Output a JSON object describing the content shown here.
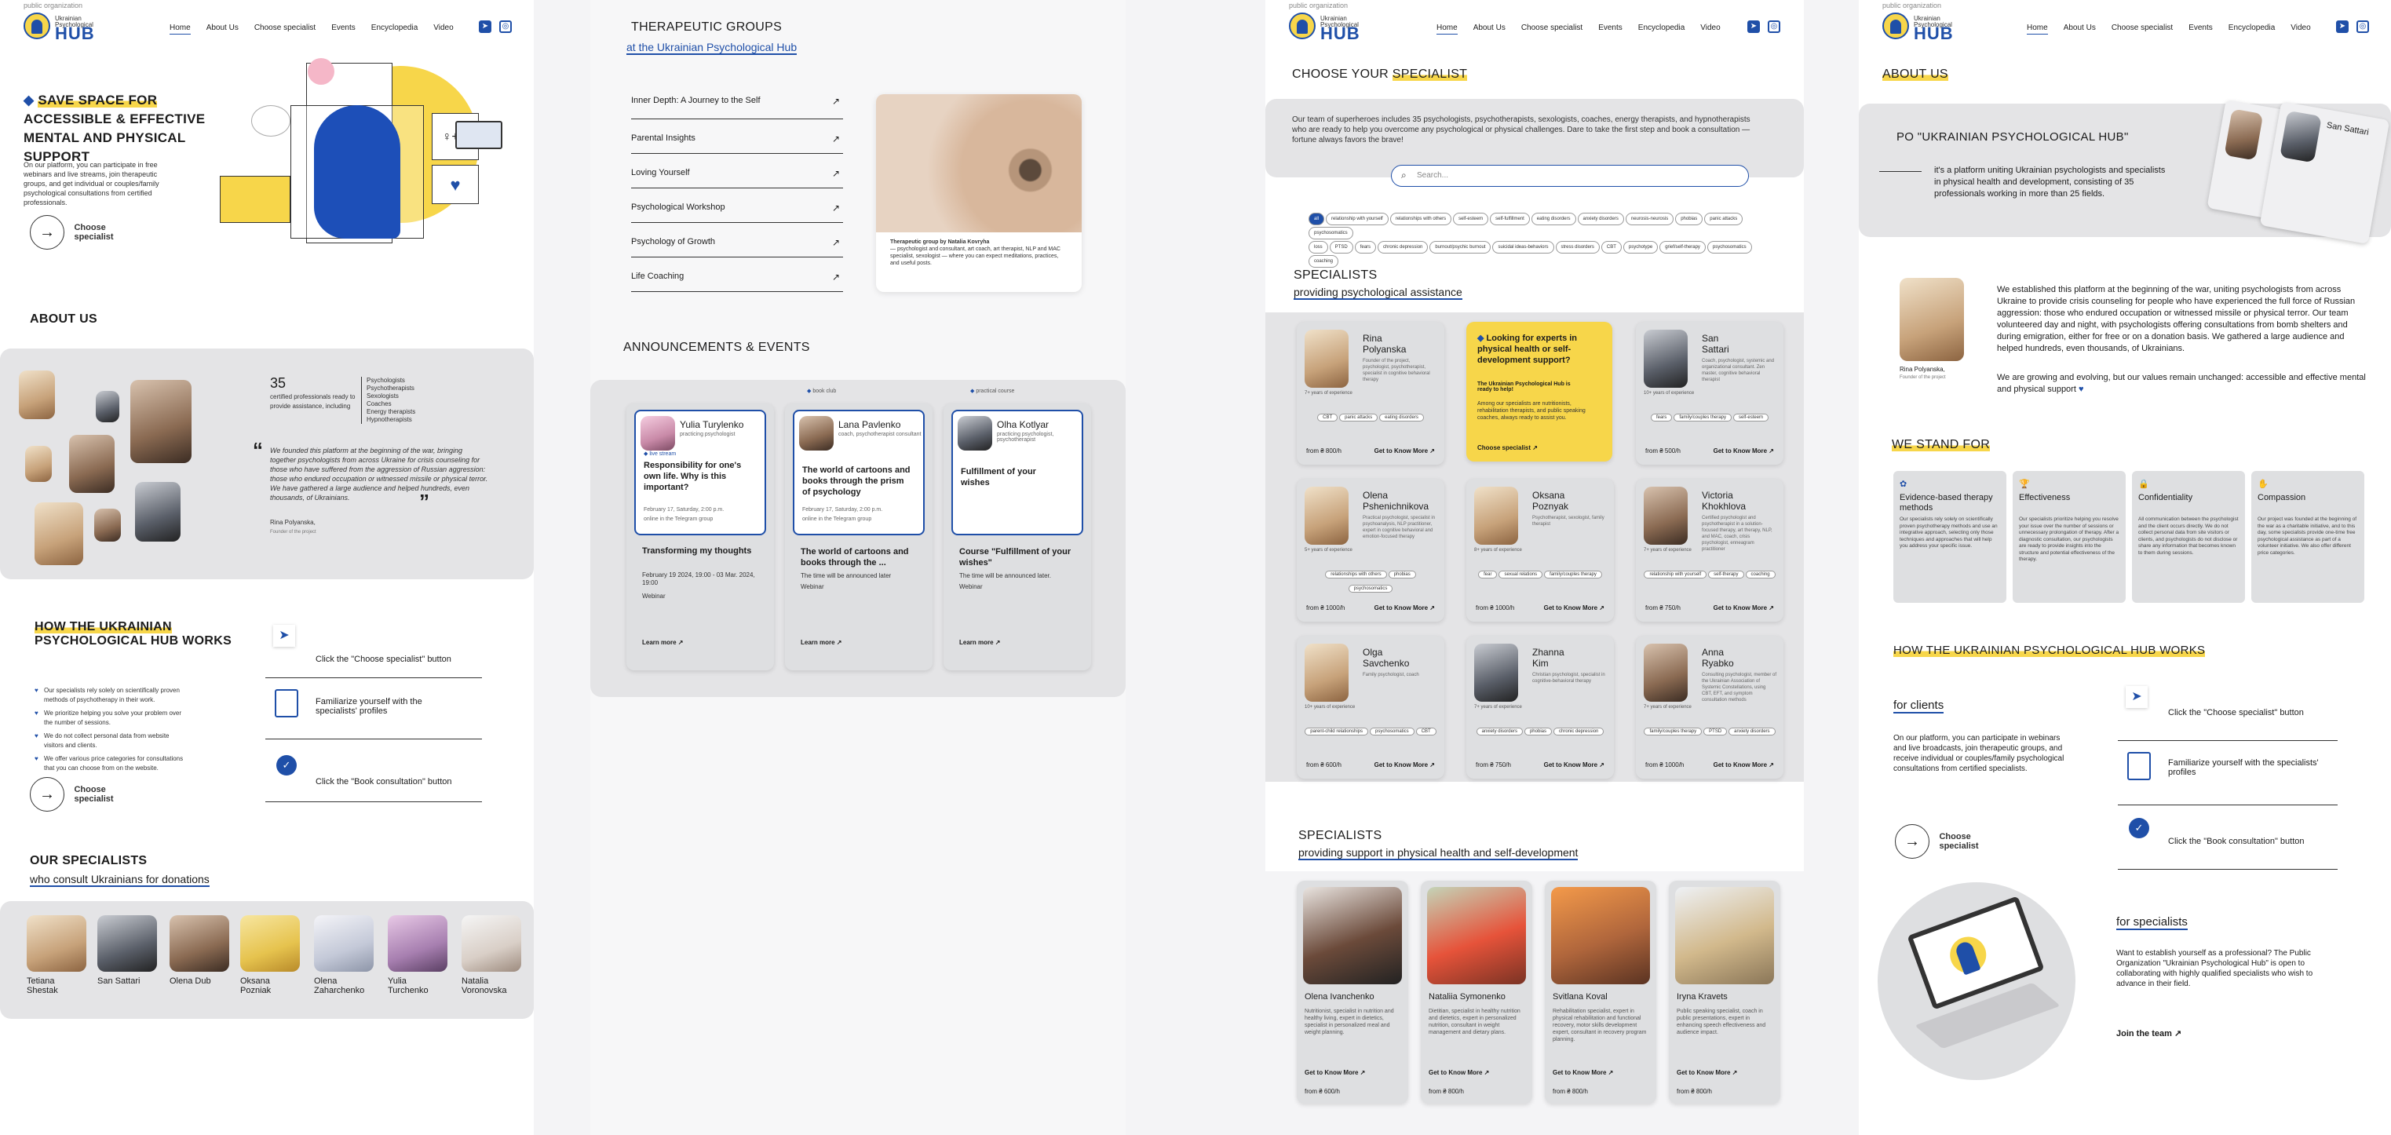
{
  "header": {
    "org": "public organization",
    "logo_line": "Ukrainian Psychological",
    "logo_hub": "HUB",
    "nav": [
      "Home",
      "About Us",
      "Choose specialist",
      "Events",
      "Encyclopedia",
      "Video"
    ],
    "social": [
      "telegram-icon",
      "instagram-icon"
    ]
  },
  "p1": {
    "hero_title_1": "SAVE SPACE FOR",
    "hero_title_2": "ACCESSIBLE & EFFECTIVE",
    "hero_title_3": "MENTAL AND PHYSICAL SUPPORT",
    "hero_text": "On our platform, you can participate in free webinars and live streams, join therapeutic groups, and get individual or couples/family psychological consultations from certified professionals.",
    "choose_label": "Choose specialist",
    "about_title": "ABOUT US",
    "stat_number": "35",
    "stat_text": "certified professionals ready to provide assistance, including",
    "stat_roles": [
      "Psychologists",
      "Psychotherapists",
      "Sexologists",
      "Coaches",
      "Energy therapists",
      "Hypnotherapists"
    ],
    "quote": "We founded this platform at the beginning of the war, bringing together psychologists from across Ukraine for crisis counseling for those who have suffered from the aggression of Russian aggression: those who endured occupation or witnessed missile or physical terror. We have gathered a large audience and helped hundreds, even thousands, of Ukrainians.",
    "quote_author": "Rina Polyanska,",
    "quote_role": "Founder of the project",
    "how_title_1": "HOW THE UKRAINIAN",
    "how_title_2": "PSYCHOLOGICAL HUB WORKS",
    "how_points": [
      "Our specialists rely solely on scientifically proven methods of psychotherapy in their work.",
      "We prioritize helping you solve your problem over the number of sessions.",
      "We do not collect personal data from website visitors and clients.",
      "We offer various price categories for consultations that you can choose from on the website."
    ],
    "steps": [
      "Click the \"Choose specialist\" button",
      "Familiarize yourself with the specialists' profiles",
      "Click the \"Book consultation\" button"
    ],
    "spec_title": "OUR SPECIALISTS",
    "spec_sub": "who consult Ukrainians for donations",
    "specialists": [
      {
        "first": "Tetiana",
        "last": "Shestak"
      },
      {
        "first": "San Sattari",
        "last": ""
      },
      {
        "first": "Olena Dub",
        "last": ""
      },
      {
        "first": "Oksana",
        "last": "Pozniak"
      },
      {
        "first": "Olena",
        "last": "Zaharchenko"
      },
      {
        "first": "Yulia",
        "last": "Turchenko"
      },
      {
        "first": "Natalia",
        "last": "Voronovska"
      }
    ]
  },
  "p2": {
    "title": "THERAPEUTIC GROUPS",
    "sub": "at the Ukrainian Psychological Hub",
    "groups": [
      "Inner Depth: A Journey to the Self",
      "Parental Insights",
      "Loving Yourself",
      "Psychological Workshop",
      "Psychology of Growth",
      "Life Coaching"
    ],
    "img_caption_b": "Therapeutic group by Natalia Kovryha",
    "img_caption": "— psychologist and consultant, art coach, art therapist, NLP and MAC specialist, sexologist — where you can expect meditations, practices, and useful posts.",
    "ann_title": "ANNOUNCEMENTS & EVENTS",
    "events": [
      {
        "badge": "",
        "name": "Yulia Turylenko",
        "role": "practicing psychologist",
        "tag": "live stream",
        "title": "Responsibility for one's own life. Why is this important?",
        "date": "February 17, Saturday, 2:00 p.m.",
        "place": "online in the Telegram group",
        "head": "Transforming my thoughts",
        "info": "February 19 2024, 19:00 - 03 Mar. 2024, 19:00",
        "type": "Webinar",
        "more": "Learn more ↗"
      },
      {
        "badge": "book club",
        "name": "Lana Pavlenko",
        "role": "coach, psychotherapist consultant",
        "tag": "",
        "title": "The world of cartoons and books through the prism of psychology",
        "date": "February 17, Saturday, 2:00 p.m.",
        "place": "online in the Telegram group",
        "head": "The world of cartoons and books through the ...",
        "info": "The time will be announced later",
        "type": "Webinar",
        "more": "Learn more ↗"
      },
      {
        "badge": "practical course",
        "name": "Olha Kotlyar",
        "role": "practicing psychologist, psychotherapist",
        "tag": "",
        "title": "Fulfillment of your wishes",
        "date": "",
        "place": "",
        "head": "Course \"Fulfillment of your wishes\"",
        "info": "The time will be announced later.",
        "type": "Webinar",
        "more": "Learn more ↗"
      }
    ]
  },
  "p3": {
    "title_a": "CHOOSE YOUR ",
    "title_b": "SPECIALIST",
    "intro": "Our team of superheroes includes 35 psychologists, psychotherapists, sexologists, coaches, energy therapists, and hypnotherapists who are ready to help you overcome any psychological or physical challenges. Dare to take the first step and book a consultation — fortune always favors the brave!",
    "search_placeholder": "Search...",
    "filters_1": [
      "all",
      "relationship with yourself",
      "relationships with others",
      "self-esteem",
      "self-fulfillment",
      "eating disorders",
      "anxiety disorders",
      "neurosis-neurosis",
      "phobias",
      "panic attacks",
      "psychosomatics"
    ],
    "filters_2": [
      "loss",
      "PTSD",
      "fears",
      "chronic depression",
      "burnout/psychic burnout",
      "suicidal ideas-behaviors",
      "stress disorders",
      "CBT",
      "psychotype",
      "grief/self-therapy",
      "psychosomatics",
      "coaching"
    ],
    "psych_title": "SPECIALISTS",
    "psych_sub": "providing psychological assistance",
    "cards": [
      {
        "first": "Rina",
        "last": "Polyanska",
        "desc": "Founder of the project, psychologist, psychotherapist, specialist in cognitive behavioral therapy",
        "exp": "7+ years of experience",
        "tags": [
          "CBT",
          "panic attacks",
          "eating disorders"
        ],
        "price": "from ₴ 800/h",
        "more": "Get to Know More ↗"
      },
      {
        "first": "San",
        "last": "Sattari",
        "desc": "Coach, psychologist, systemic and organizational consultant. Zen master, cognitive behavioral therapist",
        "exp": "10+ years of experience",
        "tags": [
          "fears",
          "family/couples therapy",
          "self-esteem"
        ],
        "price": "from ₴ 500/h",
        "more": "Get to Know More ↗"
      },
      {
        "first": "Olena",
        "last": "Pshenichnikova",
        "desc": "Practical psychologist, specialist in psychoanalysis, NLP practitioner, expert in cognitive behavioral and emotion-focused therapy",
        "exp": "5+ years of experience",
        "tags": [
          "relationships with others",
          "phobias",
          "psychosomatics"
        ],
        "price": "from ₴ 1000/h",
        "more": "Get to Know More ↗"
      },
      {
        "first": "Oksana",
        "last": "Poznyak",
        "desc": "Psychotherapist, sexologist, family therapist",
        "exp": "8+ years of experience",
        "tags": [
          "fear",
          "sexual relations",
          "family/couples therapy"
        ],
        "price": "from ₴ 1000/h",
        "more": "Get to Know More ↗"
      },
      {
        "first": "Victoria",
        "last": "Khokhlova",
        "desc": "Certified psychologist and psychotherapist in a solution-focused therapy, art therapy, NLP, and MAC, coach, crisis psychologist, enneagram practitioner",
        "exp": "7+ years of experience",
        "tags": [
          "relationship with yourself",
          "self-therapy",
          "coaching"
        ],
        "price": "from ₴ 750/h",
        "more": "Get to Know More ↗"
      },
      {
        "first": "Olga",
        "last": "Savchenko",
        "desc": "Family psychologist, coach",
        "exp": "10+ years of experience",
        "tags": [
          "parent-child relationships",
          "psychosomatics",
          "CBT"
        ],
        "price": "from ₴ 600/h",
        "more": "Get to Know More ↗"
      },
      {
        "first": "Zhanna",
        "last": "Kim",
        "desc": "Christian psychologist, specialist in cognitive-behavioral therapy",
        "exp": "7+ years of experience",
        "tags": [
          "anxiety disorders",
          "phobias",
          "chronic depression"
        ],
        "price": "from ₴ 750/h",
        "more": "Get to Know More ↗"
      },
      {
        "first": "Anna",
        "last": "Ryabko",
        "desc": "Consulting psychologist, member of the Ukrainian Association of Systemic Constellations, using CBT, EFT, and symptom consultation methods",
        "exp": "7+ years of experience",
        "tags": [
          "family/couples therapy",
          "PTSD",
          "anxiety disorders"
        ],
        "price": "from ₴ 1000/h",
        "more": "Get to Know More ↗"
      }
    ],
    "promo_title": "Looking for experts in physical health or self-development support?",
    "promo_b": "The Ukrainian Psychological Hub is ready to help!",
    "promo_text": "Among our specialists are nutritionists, rehabilitation therapists, and public speaking coaches, always ready to assist you.",
    "promo_link": "Choose specialist ↗",
    "phys_title": "SPECIALISTS",
    "phys_sub": "providing support in physical health and self-development",
    "phys": [
      {
        "name": "Olena Ivanchenko",
        "desc": "Nutritionist, specialist in nutrition and healthy living, expert in dietetics, specialist in personalized meal and weight planning.",
        "more": "Get to Know More ↗",
        "price": "from ₴ 600/h"
      },
      {
        "name": "Nataliia Symonenko",
        "desc": "Dietitian, specialist in healthy nutrition and dietetics, expert in personalized nutrition, consultant in weight management and dietary plans.",
        "more": "Get to Know More ↗",
        "price": "from ₴ 800/h"
      },
      {
        "name": "Svitlana Koval",
        "desc": "Rehabilitation specialist, expert in physical rehabilitation and functional recovery, motor skills development expert, consultant in recovery program planning.",
        "more": "Get to Know More ↗",
        "price": "from ₴ 800/h"
      },
      {
        "name": "Iryna Kravets",
        "desc": "Public speaking specialist, coach in public presentations, expert in enhancing speech effectiveness and audience impact.",
        "more": "Get to Know More ↗",
        "price": "from ₴ 800/h"
      }
    ]
  },
  "p4": {
    "about_title": "ABOUT US",
    "hub_title": "PO \"UKRAINIAN PSYCHOLOGICAL HUB\"",
    "hub_text": "it's a platform uniting Ukrainian psychologists and specialists in physical health and development, consisting of 35 professionals working in more than 25 fields.",
    "profile_name": "San Sattari",
    "story_1": "We established this platform at the beginning of the war, uniting psychologists from across Ukraine to provide crisis counseling for people who have experienced the full force of Russian aggression: those who endured occupation or witnessed missile or physical terror. Our team volunteered day and night, with psychologists offering consultations from bomb shelters and during emigration, either for free or on a donation basis. We gathered a large audience and helped hundreds, even thousands, of Ukrainians.",
    "story_2": "We are growing and evolving, but our values remain unchanged: accessible and effective mental and physical support",
    "author": "Rina Polyanska,",
    "author_role": "Founder of the project",
    "stand_title": "WE STAND FOR",
    "values": [
      {
        "icon": "lotus-icon",
        "title": "Evidence-based therapy methods",
        "text": "Our specialists rely solely on scientifically proven psychotherapy methods and use an integrative approach, selecting only those techniques and approaches that will help you address your specific issue."
      },
      {
        "icon": "trophy-icon",
        "title": "Effectiveness",
        "text": "Our specialists prioritize helping you resolve your issue over the number of sessions or unnecessary prolongation of therapy. After a diagnostic consultation, our psychologists are ready to provide insights into the structure and potential effectiveness of the therapy."
      },
      {
        "icon": "lock-icon",
        "title": "Confidentiality",
        "text": "All communication between the psychologist and the client occurs directly. We do not collect personal data from site visitors or clients, and psychologists do not disclose or share any information that becomes known to them during sessions."
      },
      {
        "icon": "hands-icon",
        "title": "Compassion",
        "text": "Our project was founded at the beginning of the war as a charitable initiative, and to this day, some specialists provide one-time free psychological assistance as part of a volunteer initiative. We also offer different price categories."
      }
    ],
    "how_title": "HOW THE UKRAINIAN PSYCHOLOGICAL HUB WORKS",
    "clients_title": "for clients",
    "clients_text": "On our platform, you can participate in webinars and live broadcasts, join therapeutic groups, and receive individual or couples/family psychological consultations from certified specialists.",
    "steps": [
      "Click the \"Choose specialist\" button",
      "Familiarize yourself with the specialists' profiles",
      "Click the \"Book consultation\" button"
    ],
    "choose_label": "Choose specialist",
    "spec_title": "for specialists",
    "spec_text": "Want to establish yourself as a professional? The Public Organization \"Ukrainian Psychological Hub\" is open to collaborating with highly qualified specialists who wish to advance in their field.",
    "join": "Join the team ↗"
  }
}
